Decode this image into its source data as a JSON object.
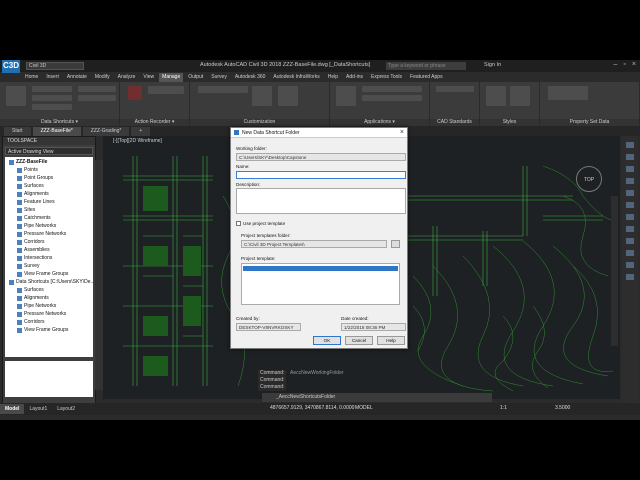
{
  "app": {
    "logo": "C3D",
    "workspace": "Civil 3D",
    "title": "Autodesk AutoCAD Civil 3D 2018    ZZZ-BaseFile.dwg [_DataShortcuts]",
    "search_placeholder": "Type a keyword or phrase",
    "signin": "Sign In"
  },
  "ribbon_tabs": [
    "Home",
    "Insert",
    "Annotate",
    "Modify",
    "Analyze",
    "View",
    "Manage",
    "Output",
    "Survey",
    "Autodesk 360",
    "Autodesk InfraWorks",
    "Help",
    "Add-ins",
    "Express Tools",
    "Featured Apps"
  ],
  "active_tab": "Manage",
  "ribbon_panels": [
    "Data Shortcuts ▾",
    "Action Recorder ▾",
    "Customization",
    "Applications ▾",
    "CAD Standards",
    "Styles",
    "Property Set Data"
  ],
  "file_tabs": [
    "Start",
    "ZZZ-BaseFile*",
    "ZZZ-Grading*"
  ],
  "toolspace": {
    "title": "TOOLSPACE",
    "view": "Active Drawing View",
    "items": [
      {
        "label": "ZZZ-BaseFile",
        "bold": true,
        "indent": 1
      },
      {
        "label": "Points",
        "indent": 3
      },
      {
        "label": "Point Groups",
        "indent": 3
      },
      {
        "label": "Surfaces",
        "indent": 3
      },
      {
        "label": "Alignments",
        "indent": 3
      },
      {
        "label": "Feature Lines",
        "indent": 3
      },
      {
        "label": "Sites",
        "indent": 3
      },
      {
        "label": "Catchments",
        "indent": 3
      },
      {
        "label": "Pipe Networks",
        "indent": 3
      },
      {
        "label": "Pressure Networks",
        "indent": 3
      },
      {
        "label": "Corridors",
        "indent": 3
      },
      {
        "label": "Assemblies",
        "indent": 3
      },
      {
        "label": "Intersections",
        "indent": 3
      },
      {
        "label": "Survey",
        "indent": 3
      },
      {
        "label": "View Frame Groups",
        "indent": 3
      },
      {
        "label": "Data Shortcuts [C:\\Users\\SKY\\De...",
        "indent": 1
      },
      {
        "label": "Surfaces",
        "indent": 3
      },
      {
        "label": "Alignments",
        "indent": 3
      },
      {
        "label": "Pipe Networks",
        "indent": 3
      },
      {
        "label": "Pressure Networks",
        "indent": 3
      },
      {
        "label": "Corridors",
        "indent": 3
      },
      {
        "label": "View Frame Groups",
        "indent": 3
      }
    ]
  },
  "viewport_label": "[-][Top][2D Wireframe]",
  "viewcube_label": "TOP",
  "dialog": {
    "title": "New Data Shortcut Folder",
    "working_folder_label": "Working folder:",
    "working_folder": "C:\\Users\\SKY\\Desktop\\Capstone",
    "name_label": "Name:",
    "name_value": "",
    "description_label": "Description:",
    "use_template_label": "Use project template",
    "template_folder_label": "Project templates folder:",
    "template_folder": "C:\\Civil 3D Project Templates\\",
    "template_label": "Project template:",
    "created_by_label": "Created by:",
    "created_by": "DESKTOP-V8NVRKOSKY",
    "date_label": "Date created:",
    "date": "1/22/2018 08:36 PM",
    "ok": "OK",
    "cancel": "Cancel",
    "help": "Help"
  },
  "command": {
    "history": [
      "Command:",
      "Command:",
      "Command:"
    ],
    "prompt": "_AeccNewShortcutsFolder",
    "ghost": "AeccNewWorkingFolder"
  },
  "layout_tabs": [
    "Model",
    "Layout1",
    "Layout2"
  ],
  "status": {
    "coords": "4876657.9129, 3470867.8114, 0.0000",
    "model": "MODEL",
    "scale": "1:1",
    "value": "3.5000"
  }
}
